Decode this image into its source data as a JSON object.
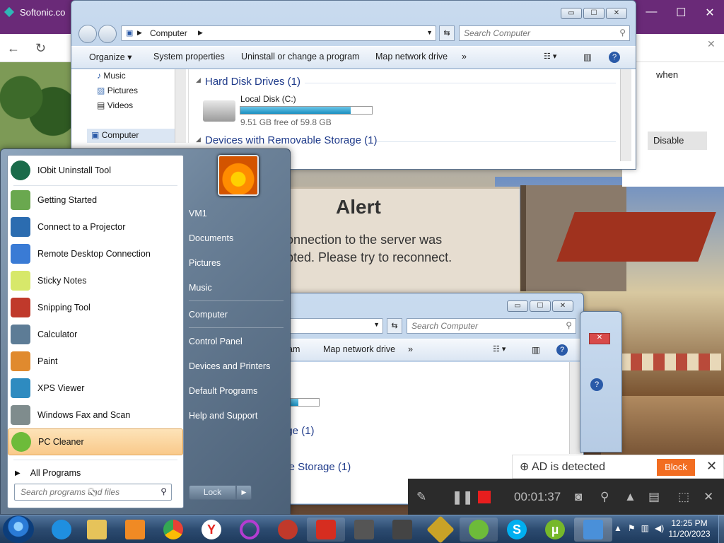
{
  "browser": {
    "tab_title": "Softonic.co",
    "controls": [
      "—",
      "☐",
      "✕"
    ],
    "side_when": "when",
    "side_disable": "Disable"
  },
  "alert": {
    "title": "Alert",
    "message_line1": "onnection to the server was",
    "message_line2": "pted. Please try to reconnect."
  },
  "explorer_front": {
    "address": "Computer",
    "search_placeholder": "Search Computer",
    "toolbar": [
      "Organize ▾",
      "System properties",
      "Uninstall or change a program",
      "Map network drive",
      "»"
    ],
    "nav": [
      "Music",
      "Pictures",
      "Videos",
      "Computer"
    ],
    "group_hdd": "Hard Disk Drives (1)",
    "drive_name": "Local Disk (C:)",
    "drive_free": "9.51 GB free of 59.8 GB",
    "drive_used_fraction": 0.84,
    "group_removable": "Devices with Removable Storage (1)"
  },
  "explorer_back": {
    "search_placeholder": "Search Computer",
    "toolbar_partial": "am",
    "toolbar_map": "Map network drive",
    "toolbar_more": "»",
    "group_partial": "age (1)",
    "group2_partial": "ble Storage (1)"
  },
  "start_menu": {
    "programs": [
      {
        "label": "IObit Uninstall Tool",
        "icon": "iobit-icon",
        "color": "#1a6b4a"
      },
      {
        "label": "Getting Started",
        "icon": "getting-started-icon",
        "color": "#6aa84f"
      },
      {
        "label": "Connect to a Projector",
        "icon": "projector-icon",
        "color": "#2b6cb0"
      },
      {
        "label": "Remote Desktop Connection",
        "icon": "remote-desktop-icon",
        "color": "#3a7bd5"
      },
      {
        "label": "Sticky Notes",
        "icon": "sticky-notes-icon",
        "color": "#d7e86a"
      },
      {
        "label": "Snipping Tool",
        "icon": "scissors-icon",
        "color": "#c0392b"
      },
      {
        "label": "Calculator",
        "icon": "calculator-icon",
        "color": "#5d7c96"
      },
      {
        "label": "Paint",
        "icon": "paint-icon",
        "color": "#e08a2e"
      },
      {
        "label": "XPS Viewer",
        "icon": "xps-icon",
        "color": "#2e8bc0"
      },
      {
        "label": "Windows Fax and Scan",
        "icon": "fax-icon",
        "color": "#7f8c8d"
      },
      {
        "label": "PC Cleaner",
        "icon": "pc-cleaner-icon",
        "color": "#6dbb3a"
      }
    ],
    "all_programs": "All Programs",
    "search_placeholder": "Search programs and files",
    "right_items": [
      "VM1",
      "Documents",
      "Pictures",
      "Music",
      "Computer",
      "Control Panel",
      "Devices and Printers",
      "Default Programs",
      "Help and Support"
    ],
    "lock": "Lock"
  },
  "ad": {
    "text": "AD is detected",
    "block": "Block"
  },
  "recorder": {
    "time": "00:01:37"
  },
  "taskbar": {
    "time": "12:25 PM",
    "date": "11/20/2023",
    "apps": [
      {
        "name": "internet-explorer-icon",
        "color": "#1f8fe0"
      },
      {
        "name": "file-explorer-icon",
        "color": "#e6c35a"
      },
      {
        "name": "media-player-icon",
        "color": "#f08a24"
      },
      {
        "name": "chrome-icon",
        "color": "#e94235"
      },
      {
        "name": "yandex-icon",
        "color": "#e52620"
      },
      {
        "name": "opera-gx-icon",
        "color": "#b43cd1"
      },
      {
        "name": "apex-icon",
        "color": "#c0392b"
      },
      {
        "name": "video-recorder-icon",
        "color": "#d62d20"
      },
      {
        "name": "world-of-tanks-icon",
        "color": "#555"
      },
      {
        "name": "world-of-warships-icon",
        "color": "#444"
      },
      {
        "name": "game-launcher-icon",
        "color": "#c9a227"
      },
      {
        "name": "pc-cleaner-icon",
        "color": "#6dbb3a"
      },
      {
        "name": "skype-icon",
        "color": "#00aff0"
      },
      {
        "name": "utorrent-icon",
        "color": "#76b82a"
      },
      {
        "name": "control-panel-icon",
        "color": "#4a90d9"
      }
    ]
  }
}
